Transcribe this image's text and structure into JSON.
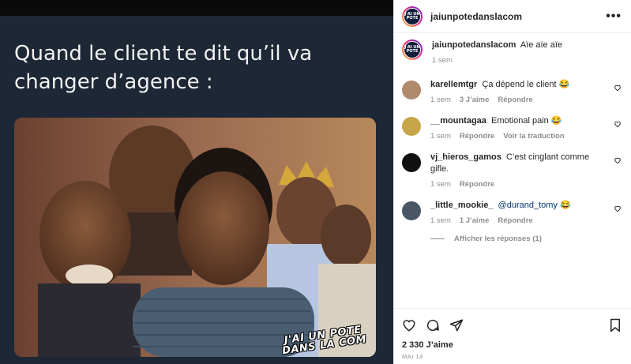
{
  "post": {
    "meme_caption": "Quand le client te dit qu’il va changer d’agence :",
    "watermark_line1": "J'AI UN POTE",
    "watermark_line2": "DANS LA COM"
  },
  "header": {
    "username": "jaiunpotedanslacom",
    "avatar_text": "J'AI UN POTE"
  },
  "caption": {
    "username": "jaiunpotedanslacom",
    "text": "Aïe aïe aïe",
    "time": "1 sem"
  },
  "comments": [
    {
      "username": "karellemtgr",
      "text": "Ça dépend le client 😂",
      "mention": "",
      "time": "1 sem",
      "likes": "3 J’aime",
      "reply": "Répondre",
      "extra": "",
      "avatar_color": "#b08a6c"
    },
    {
      "username": "__mountagaa",
      "text": "Emotional pain 😂",
      "mention": "",
      "time": "1 sem",
      "likes": "",
      "reply": "Répondre",
      "extra": "Voir la traduction",
      "avatar_color": "#c7a64a"
    },
    {
      "username": "vj_hieros_gamos",
      "text": "C’est cinglant comme gifle.",
      "mention": "",
      "time": "1 sem",
      "likes": "",
      "reply": "Répondre",
      "extra": "",
      "avatar_color": "#111111"
    },
    {
      "username": "_little_mookie_",
      "text": " 😂",
      "mention": "@durand_tomy",
      "time": "1 sem",
      "likes": "1 J’aime",
      "reply": "Répondre",
      "extra": "",
      "avatar_color": "#4a5566"
    }
  ],
  "view_replies": "Afficher les réponses (1)",
  "actions": {
    "likes": "2 330 J’aime",
    "date": "MAI 14"
  },
  "icons": [
    "more-icon",
    "heart-icon",
    "comment-icon",
    "share-icon",
    "save-icon"
  ],
  "colors": {
    "text": "#262626",
    "secondary": "#8e8e8e",
    "media_bg": "#1d2735",
    "mention": "#00376b"
  }
}
